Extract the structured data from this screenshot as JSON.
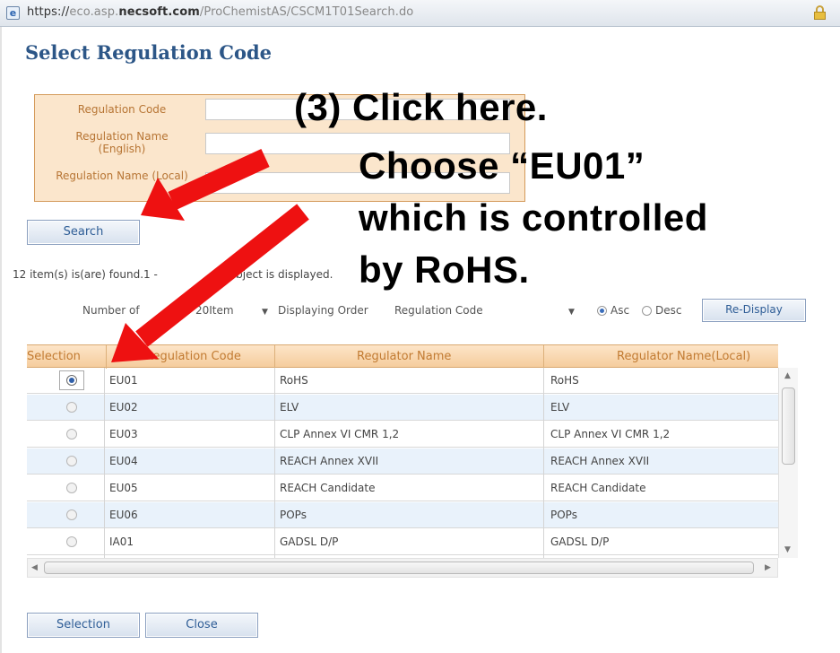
{
  "browser": {
    "url_scheme": "https://",
    "url_host_light": "eco.asp.",
    "url_host_bold": "necsoft.com",
    "url_path": "/ProChemistAS/CSCM1T01Search.do"
  },
  "page_title": "Select Regulation Code",
  "search_form": {
    "regulation_code_label": "Regulation Code",
    "regulation_name_english_label": "Regulation Name (English)",
    "regulation_name_local_label": "Regulation Name (Local)",
    "search_button": "Search"
  },
  "result": {
    "found_text_a": "12 item(s) is(are) found.1 -",
    "found_text_b": "object is displayed."
  },
  "options": {
    "number_label": "Number of",
    "number_value": "20Item",
    "order_label": "Displaying Order",
    "order_value": "Regulation Code",
    "asc_label": "Asc",
    "desc_label": "Desc",
    "redisplay_button": "Re-Display"
  },
  "table": {
    "headers": [
      "Selection",
      "Regulation Code",
      "Regulator Name",
      "Regulator Name(Local)"
    ],
    "rows": [
      {
        "code": "EU01",
        "name": "RoHS",
        "local": "RoHS",
        "selected": true
      },
      {
        "code": "EU02",
        "name": "ELV",
        "local": "ELV",
        "selected": false
      },
      {
        "code": "EU03",
        "name": "CLP Annex VI CMR 1,2",
        "local": "CLP Annex VI CMR 1,2",
        "selected": false
      },
      {
        "code": "EU04",
        "name": "REACH Annex XVII",
        "local": "REACH Annex XVII",
        "selected": false
      },
      {
        "code": "EU05",
        "name": "REACH Candidate",
        "local": "REACH Candidate",
        "selected": false
      },
      {
        "code": "EU06",
        "name": "POPs",
        "local": "POPs",
        "selected": false
      },
      {
        "code": "IA01",
        "name": "GADSL D/P",
        "local": "GADSL D/P",
        "selected": false
      }
    ]
  },
  "footer": {
    "selection_button": "Selection",
    "close_button": "Close"
  },
  "annotations": {
    "step": "(3) Click here.",
    "line1": "Choose “EU01”",
    "line2": "which is controlled",
    "line3": "by RoHS."
  },
  "colors": {
    "title_blue": "#2c5687",
    "form_bg": "#fbe6cc",
    "header_orange": "#c27b32",
    "arrow_red": "#ee1111",
    "row_alt": "#e9f2fb"
  }
}
